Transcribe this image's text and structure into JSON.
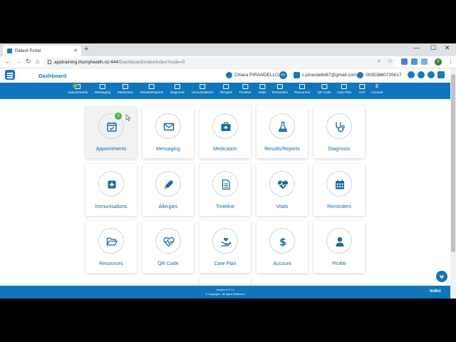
{
  "browser": {
    "tab_title": "Patient Portal",
    "url_host": "apptraining.ihsmyhealth.nz:444",
    "url_path": "/Dashboard/index/index?code=0",
    "profile_initial": "8"
  },
  "header": {
    "title": "Dashboard",
    "user_name": "Chiara PIRANDELLO",
    "nhi_label": "NHI",
    "email": "c.pirandello67@gmail.com",
    "phone": "00353860735617"
  },
  "nav": {
    "items": [
      {
        "label": "Appointments",
        "badge": "0"
      },
      {
        "label": "Messaging"
      },
      {
        "label": "Medication"
      },
      {
        "label": "Results/Reports"
      },
      {
        "label": "Diagnosis"
      },
      {
        "label": "Immunisations"
      },
      {
        "label": "Allergies"
      },
      {
        "label": "Timeline"
      },
      {
        "label": "Vitals"
      },
      {
        "label": "Reminders"
      },
      {
        "label": "Resources"
      },
      {
        "label": "QR Code"
      },
      {
        "label": "Care Plan"
      },
      {
        "label": "ACP"
      },
      {
        "label": "Account"
      }
    ]
  },
  "tiles": [
    {
      "label": "Appointments",
      "icon": "calendar-check-icon",
      "badge": "0"
    },
    {
      "label": "Messaging",
      "icon": "envelope-icon"
    },
    {
      "label": "Medication",
      "icon": "medkit-icon"
    },
    {
      "label": "Results/Reports",
      "icon": "flask-icon"
    },
    {
      "label": "Diagnosis",
      "icon": "stethoscope-icon"
    },
    {
      "label": "Immunisations",
      "icon": "plus-square-icon"
    },
    {
      "label": "Allergies",
      "icon": "wheat-icon"
    },
    {
      "label": "Timeline",
      "icon": "document-icon"
    },
    {
      "label": "Vitals",
      "icon": "heartbeat-icon"
    },
    {
      "label": "Reminders",
      "icon": "calendar-grid-icon"
    },
    {
      "label": "Resources",
      "icon": "folder-open-icon"
    },
    {
      "label": "QR Code",
      "icon": "heart-pulse-icon"
    },
    {
      "label": "Care Plan",
      "icon": "hand-heart-icon"
    },
    {
      "label": "Account",
      "icon": "dollar-icon"
    },
    {
      "label": "Profile",
      "icon": "user-icon"
    }
  ],
  "footer": {
    "version": "Version 0.4.7.0",
    "copyright": "© Copyright - All rights Reserved",
    "brand": "indici"
  },
  "colors": {
    "primary": "#0f75bc",
    "badge_green": "#4cb050",
    "tile_text": "#1a6aa8"
  }
}
